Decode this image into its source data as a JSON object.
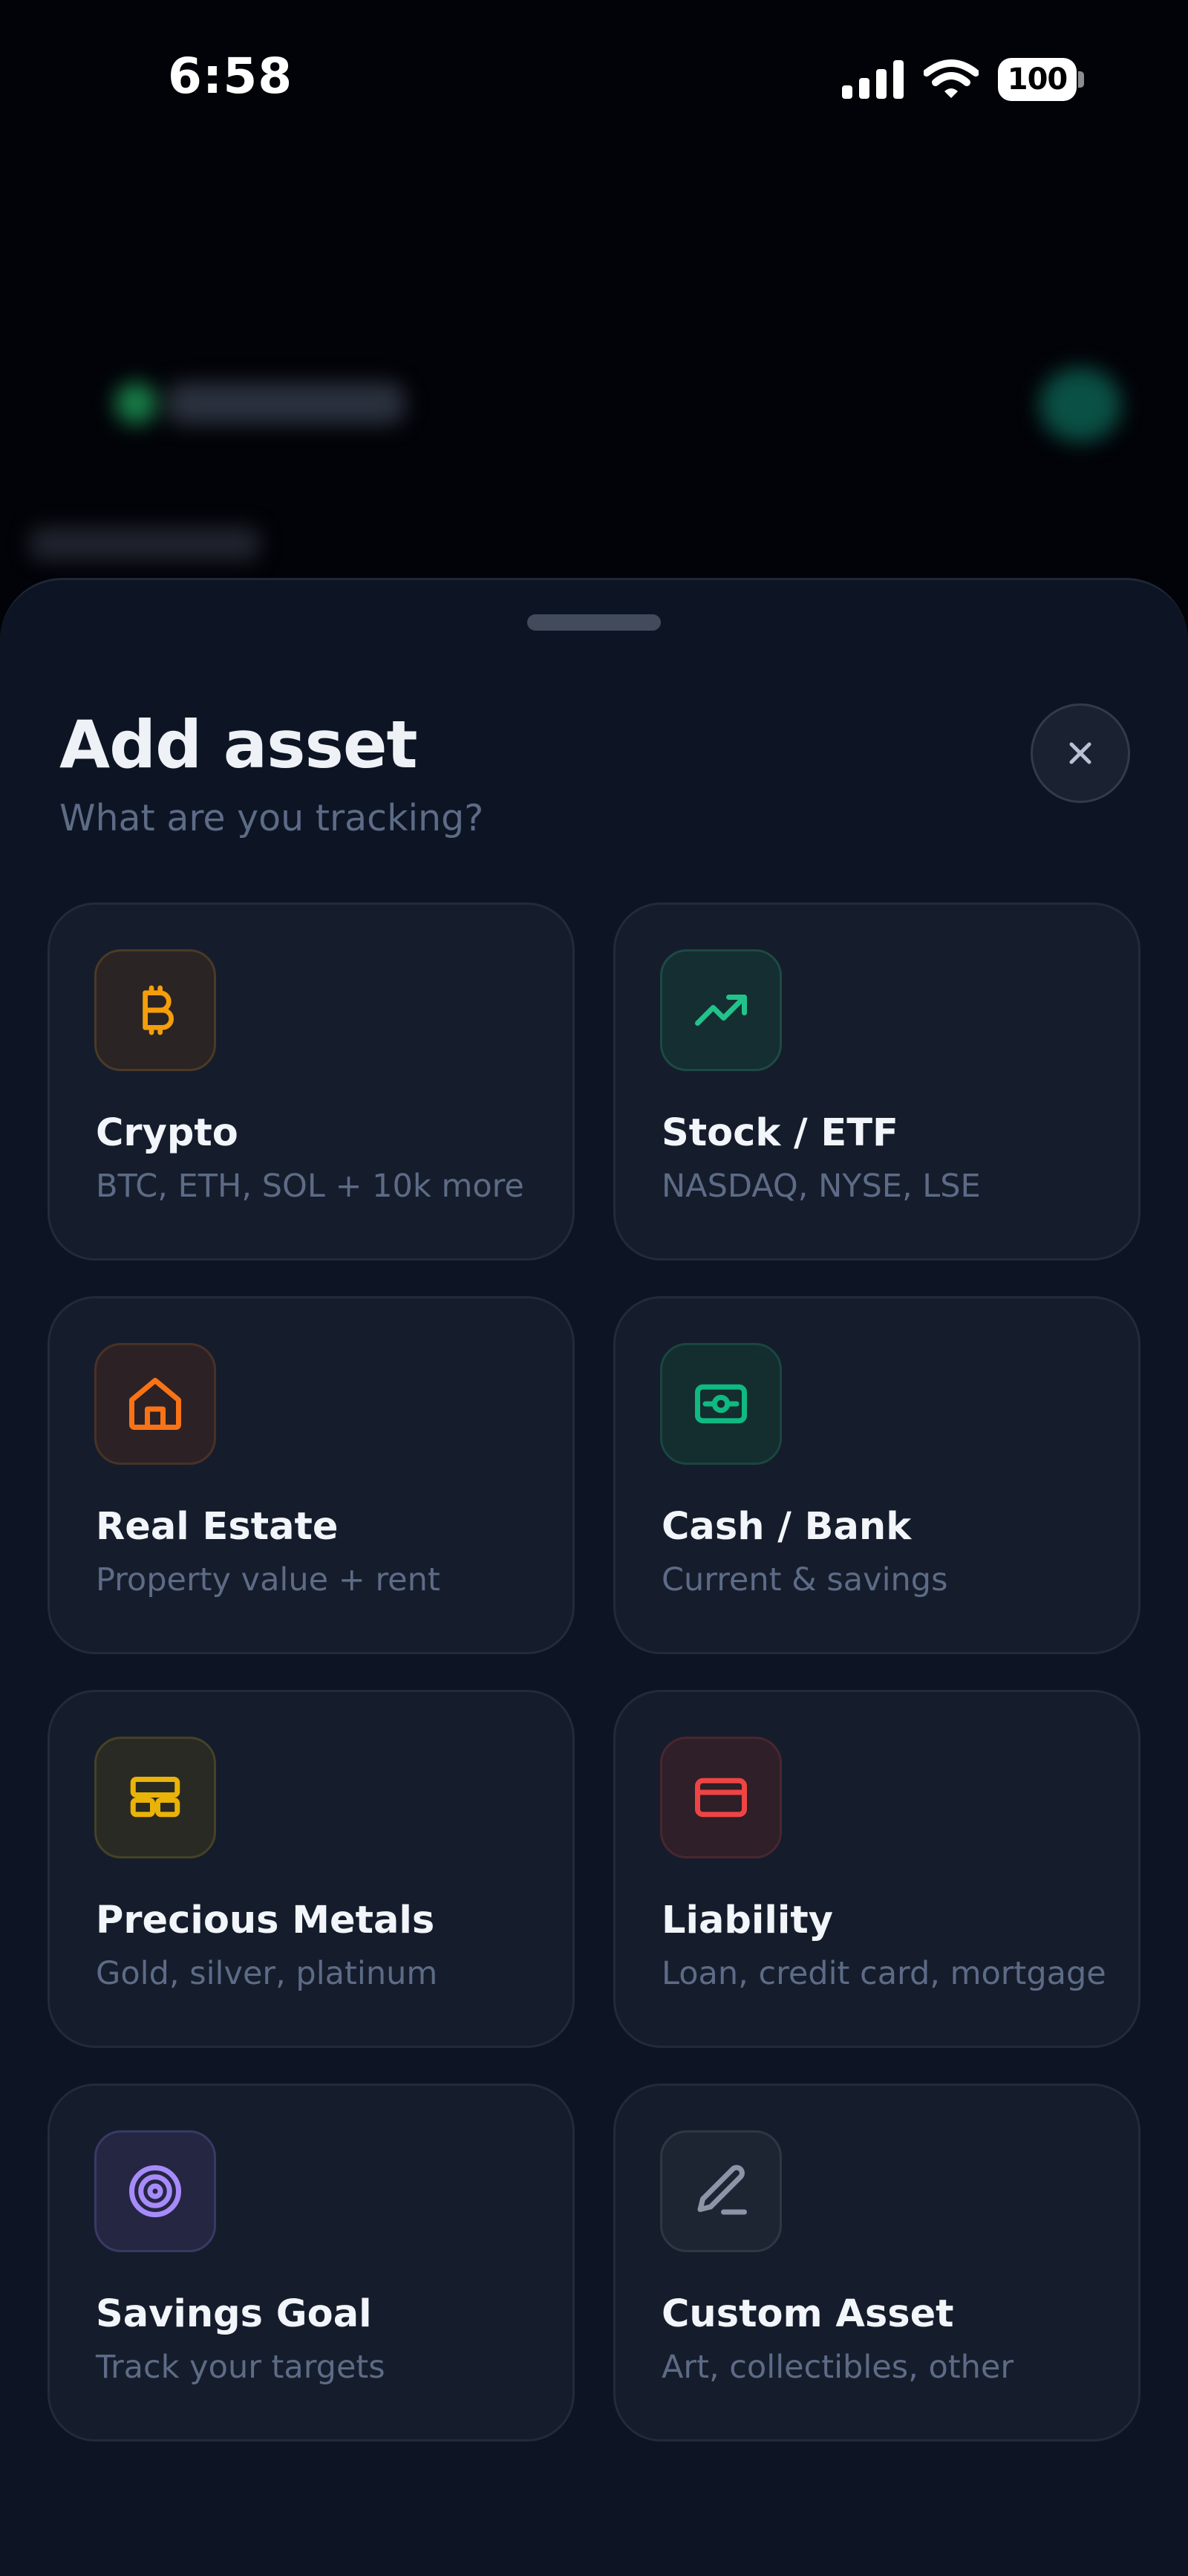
{
  "status_bar": {
    "time": "6:58",
    "battery": "100"
  },
  "sheet": {
    "title": "Add asset",
    "subtitle": "What are you tracking?",
    "close_label": "✕"
  },
  "colors": {
    "background": "#0d1524",
    "card": "#151d2c",
    "crypto": "#f59e0b",
    "stock": "#22c38a",
    "real_estate": "#f97316",
    "cash": "#10b981",
    "metals": "#eab308",
    "liability": "#ef4444",
    "savings": "#a78bfa",
    "custom": "#8b95a7"
  },
  "asset_types": [
    {
      "title": "Crypto",
      "desc": "BTC, ETH, SOL + 10k more",
      "icon": "bitcoin-icon"
    },
    {
      "title": "Stock / ETF",
      "desc": "NASDAQ, NYSE, LSE",
      "icon": "trending-up-icon"
    },
    {
      "title": "Real Estate",
      "desc": "Property value + rent",
      "icon": "house-icon"
    },
    {
      "title": "Cash / Bank",
      "desc": "Current & savings",
      "icon": "banknote-icon"
    },
    {
      "title": "Precious Metals",
      "desc": "Gold, silver, platinum",
      "icon": "gold-bars-icon"
    },
    {
      "title": "Liability",
      "desc": "Loan, credit card, mortgage",
      "icon": "credit-card-icon"
    },
    {
      "title": "Savings Goal",
      "desc": "Track your targets",
      "icon": "target-icon"
    },
    {
      "title": "Custom Asset",
      "desc": "Art, collectibles, other",
      "icon": "pencil-icon"
    }
  ]
}
